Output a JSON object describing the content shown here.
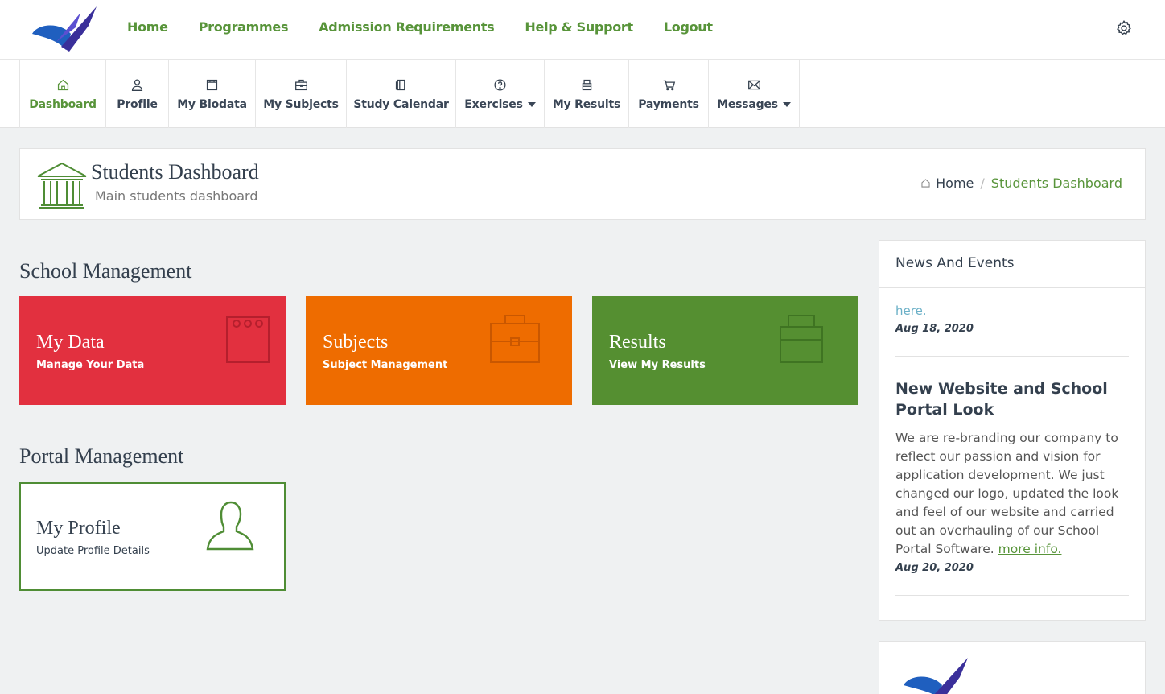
{
  "topnav": {
    "items": [
      "Home",
      "Programmes",
      "Admission Requirements",
      "Help & Support",
      "Logout"
    ]
  },
  "subnav": {
    "items": [
      {
        "label": "Dashboard",
        "icon": "home-icon",
        "active": true
      },
      {
        "label": "Profile",
        "icon": "user-icon"
      },
      {
        "label": "My Biodata",
        "icon": "calendar-icon"
      },
      {
        "label": "My Subjects",
        "icon": "briefcase-icon"
      },
      {
        "label": "Study Calendar",
        "icon": "book-icon"
      },
      {
        "label": "Exercises",
        "icon": "question-icon",
        "dropdown": true
      },
      {
        "label": "My Results",
        "icon": "printer-icon"
      },
      {
        "label": "Payments",
        "icon": "cart-icon"
      },
      {
        "label": "Messages",
        "icon": "envelope-icon",
        "dropdown": true
      }
    ]
  },
  "header": {
    "title": "Students Dashboard",
    "subtitle": "Main students dashboard",
    "breadcrumb": {
      "home": "Home",
      "current": "Students Dashboard"
    }
  },
  "school_management": {
    "title": "School Management",
    "tiles": [
      {
        "title": "My Data",
        "subtitle": "Manage Your Data",
        "color": "#e2303f"
      },
      {
        "title": "Subjects",
        "subtitle": "Subject Management",
        "color": "#ee6c00"
      },
      {
        "title": "Results",
        "subtitle": "View My Results",
        "color": "#558f31"
      }
    ]
  },
  "portal_management": {
    "title": "Portal Management",
    "tiles": [
      {
        "title": "My Profile",
        "subtitle": "Update Profile Details",
        "color": "#4f8d35"
      }
    ]
  },
  "news": {
    "title": "News And Events",
    "items": [
      {
        "link": "here.",
        "date": "Aug 18, 2020"
      },
      {
        "title": "New Website and School Portal Look",
        "text": "We are re-branding our company to reflect our passion and vision for application development. We just changed our logo, updated the look and feel of our website and carried out an overhauling of our School Portal Software.",
        "link": "more info.",
        "date": "Aug 20, 2020"
      }
    ]
  },
  "colors": {
    "accent": "#58943a",
    "text": "#34404e"
  }
}
